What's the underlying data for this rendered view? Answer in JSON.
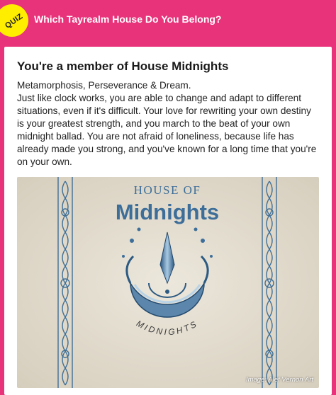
{
  "header": {
    "badge": "QUIZ",
    "title": "Which Tayrealm House Do You Belong?"
  },
  "result": {
    "title": "You're a member of House Midnights",
    "traits": "Metamorphosis, Perseverance & Dream.",
    "description": "Just like clock works, you are able to change and adapt to different situations, even if it's difficult. Your love for rewriting your own destiny is your greatest strength, and you march to the beat of your own midnight ballad. You are not afraid of loneliness, because life has already made you strong, and you've known for a long time that you're on your own."
  },
  "image": {
    "house_of": "HOUSE OF",
    "house_name": "Midnights",
    "emblem_text": "MIDNIGHTS",
    "credit": "Image: Alef Vernon Art"
  },
  "colors": {
    "background": "#e8337a",
    "badge": "#ffee00",
    "parchment": "#e3ddd0",
    "ink_blue": "#3d6e99"
  }
}
